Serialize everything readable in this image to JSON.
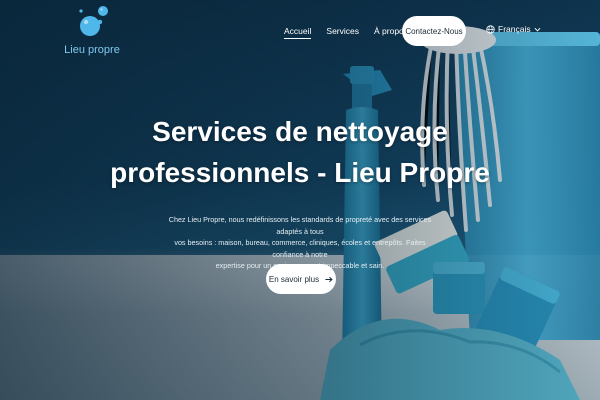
{
  "brand": {
    "name": "Lieu propre",
    "accent": "#4fb7ea"
  },
  "nav": {
    "items": [
      {
        "label": "Accueil",
        "active": true
      },
      {
        "label": "Services",
        "active": false
      },
      {
        "label": "À propos",
        "active": false
      }
    ],
    "cta_label": "Contactez-Nous",
    "language": "Français"
  },
  "hero": {
    "title_line1": "Services de nettoyage",
    "title_line2": "professionnels - Lieu Propre",
    "description_line1": "Chez Lieu Propre, nous redéfinissons les standards de propreté avec des services adaptés à tous",
    "description_line2": "vos besoins : maison, bureau, commerce, cliniques, écoles et entrepôts. Faites confiance à notre",
    "description_line3": "expertise pour un environnement impeccable et sain.",
    "button_label": "En savoir plus",
    "button_icon": "arrow-right-icon"
  }
}
